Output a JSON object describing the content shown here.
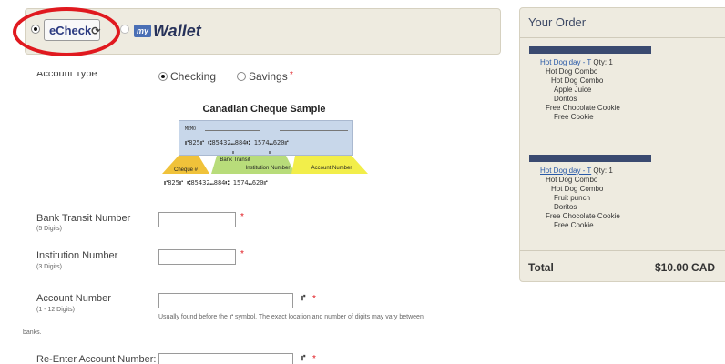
{
  "payment": {
    "echeck": {
      "label": "eCheck",
      "swirl": "⟳",
      "selected": true
    },
    "wallet": {
      "badge": "my",
      "label": "Wallet",
      "selected": false
    }
  },
  "account_type": {
    "label": "Account Type",
    "options": [
      "Checking",
      "Savings"
    ],
    "selected": "Checking",
    "required": "*"
  },
  "cheque_sample": {
    "title": "Canadian Cheque Sample",
    "memo": "MEMO",
    "micr_top": "⑈825⑈  ⑆85432⑉884⑆  1574⑉620⑈",
    "micr_bottom": "⑈825⑈  ⑆85432⑉884⑆  1574⑉620⑈",
    "tags": {
      "cheque": "Cheque #",
      "bank_transit": "Bank Transit",
      "institution": "Institution Number",
      "account": "Account Number"
    }
  },
  "fields": [
    {
      "label": "Bank Transit Number",
      "hint": "(5 Digits)",
      "value": "",
      "required": "*"
    },
    {
      "label": "Institution Number",
      "hint": "(3 Digits)",
      "value": "",
      "required": "*"
    },
    {
      "label": "Account Number",
      "hint": "(1 - 12 Digits)",
      "value": "",
      "symbol": "⑈",
      "required": "*",
      "help": "Usually found before the ⑈ symbol. The exact location and number of digits may vary between",
      "help_cont": "banks."
    },
    {
      "label": "Re-Enter Account Number:",
      "value": "",
      "symbol": "⑈",
      "required": "*"
    }
  ],
  "order": {
    "title": "Your Order",
    "groups": [
      {
        "item": "Hot Dog day - T",
        "qty": "Qty: 1",
        "lines": [
          "Hot Dog Combo",
          "Hot Dog Combo",
          "Apple Juice",
          "Doritos",
          "Free Chocolate Cookie",
          "Free Cookie"
        ]
      },
      {
        "item": "Hot Dog day - T",
        "qty": "Qty: 1",
        "lines": [
          "Hot Dog Combo",
          "Hot Dog Combo",
          "Fruit punch",
          "Doritos",
          "Free Chocolate Cookie",
          "Free Cookie"
        ]
      }
    ],
    "total_label": "Total",
    "total_value": "$10.00 CAD"
  },
  "colors": {
    "accent_red": "#e0191f",
    "panel_bg": "#eeebe0",
    "link_blue": "#2a5aa8"
  }
}
